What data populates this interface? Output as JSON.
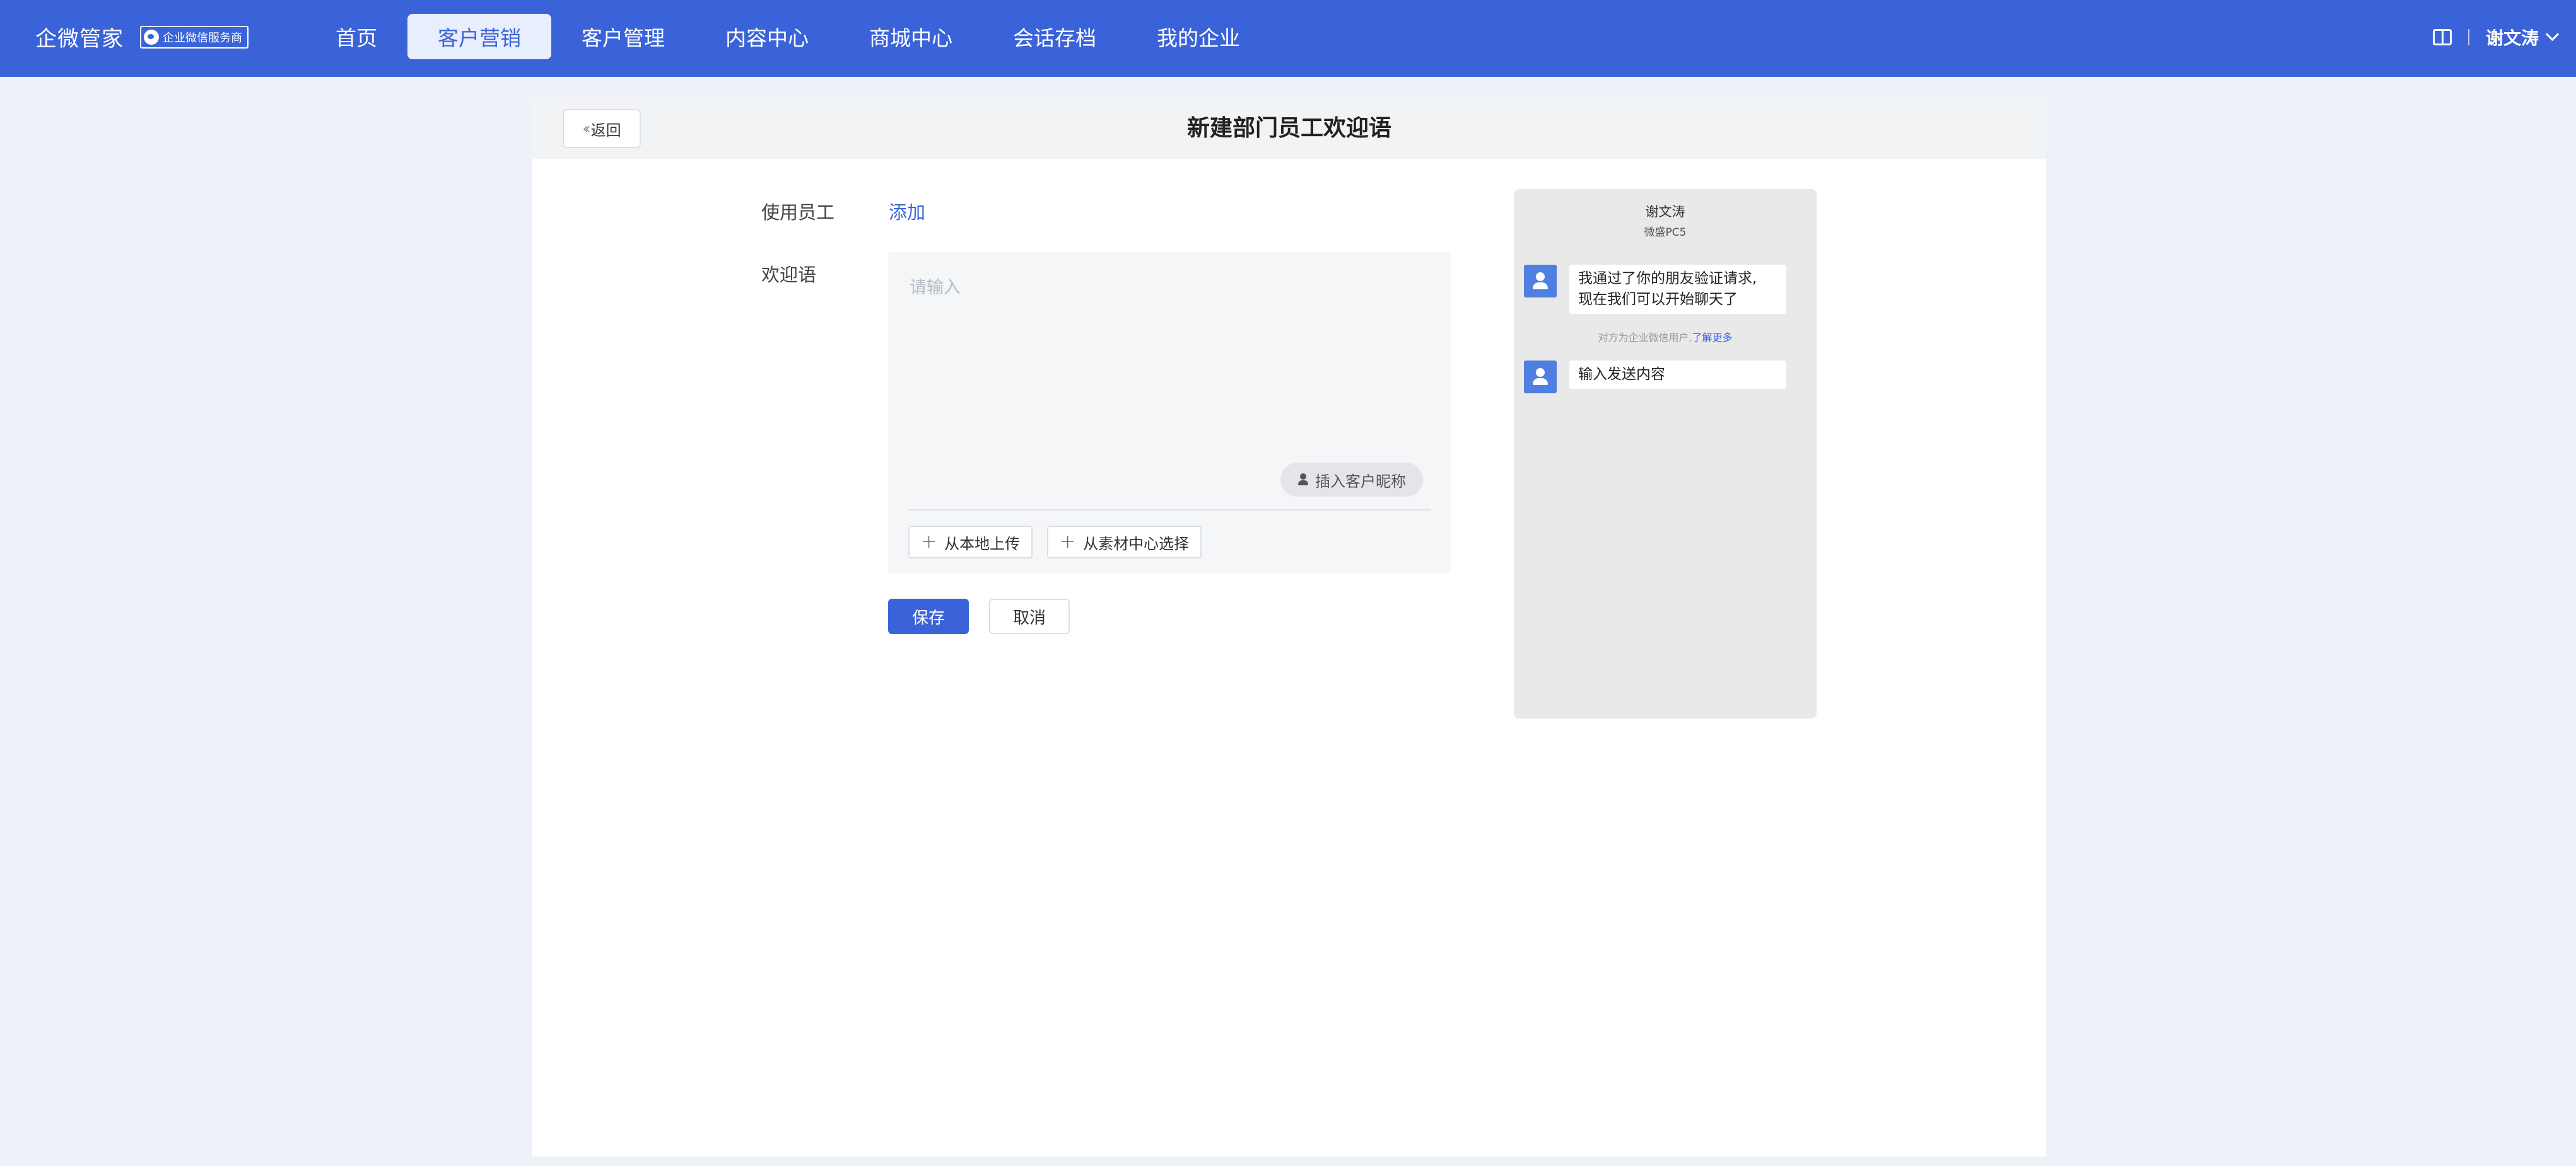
{
  "header": {
    "brand": "企微管家",
    "badge": "企业微信服务商",
    "nav": [
      "首页",
      "客户营销",
      "客户管理",
      "内容中心",
      "商城中心",
      "会话存档",
      "我的企业"
    ],
    "active_nav": "客户营销",
    "user": "谢文涛",
    "accent_color": "#3b63d9"
  },
  "page": {
    "back_label": "返回",
    "title": "新建部门员工欢迎语"
  },
  "form": {
    "staff_label": "使用员工",
    "staff_add": "添加",
    "welcome_label": "欢迎语",
    "welcome_placeholder": "请输入",
    "welcome_value": "",
    "insert_nickname": "插入客户昵称",
    "upload_local": "从本地上传",
    "upload_material": "从素材中心选择",
    "save": "保存",
    "cancel": "取消"
  },
  "preview": {
    "name": "谢文涛",
    "device": "微盛PC5",
    "first_msg_line1": "我通过了你的朋友验证请求,",
    "first_msg_line2": "现在我们可以开始聊天了",
    "note": "对方为企业微信用户,",
    "note_link": "了解更多",
    "second_msg": "输入发送内容"
  }
}
